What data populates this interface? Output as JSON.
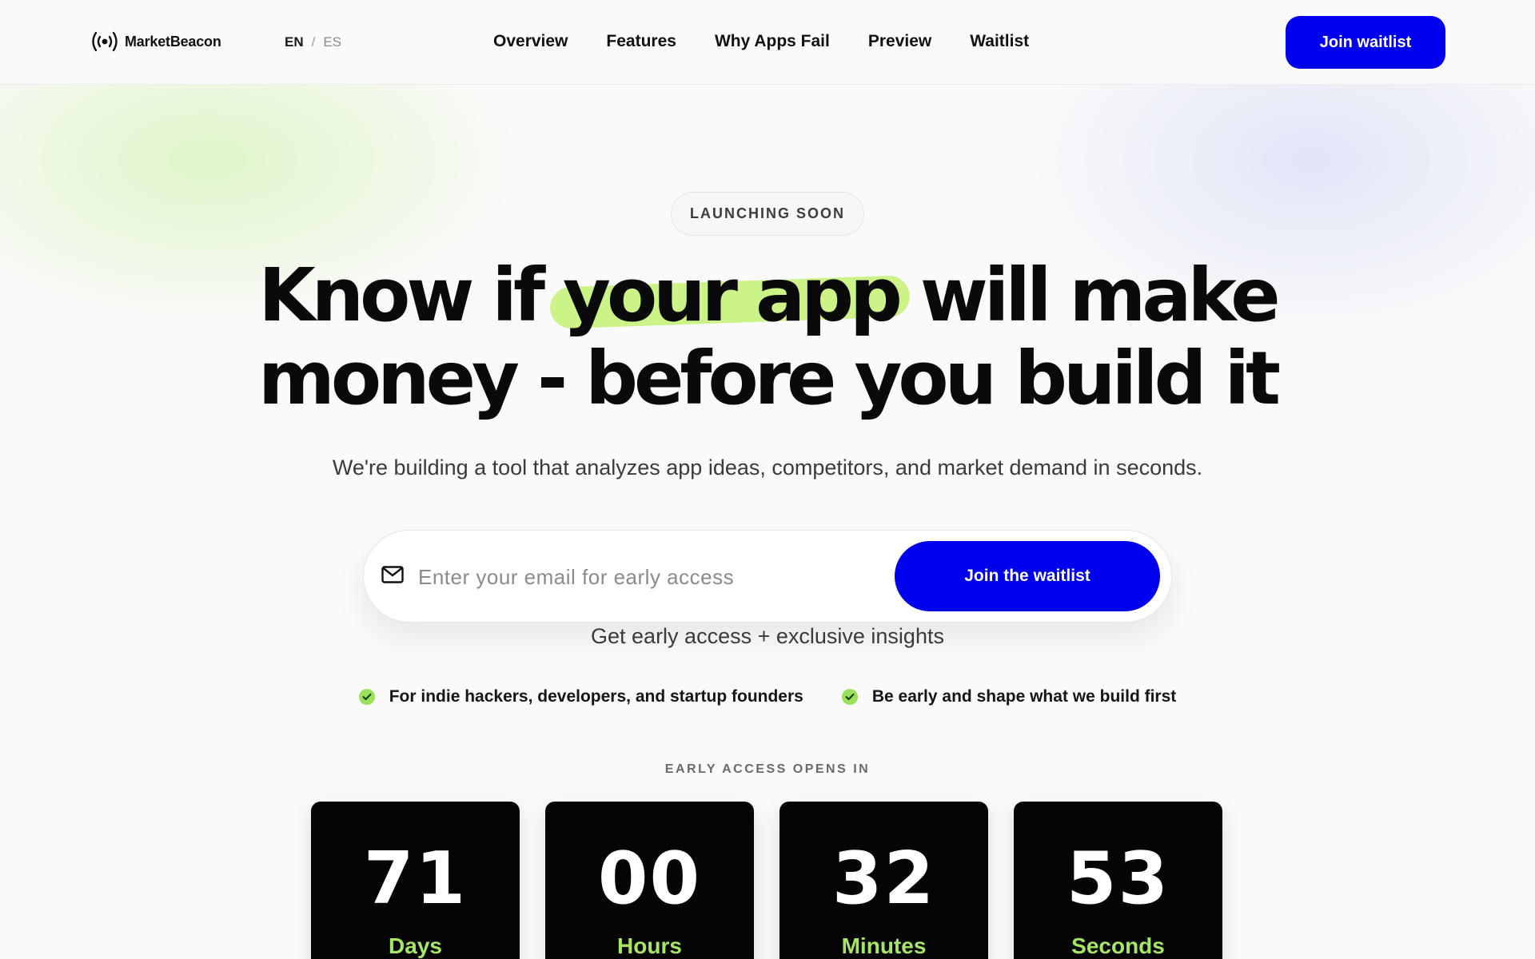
{
  "brand": {
    "name": "MarketBeacon",
    "icon": "broadcast-icon"
  },
  "language": {
    "current": "EN",
    "separator": "/",
    "other": "ES"
  },
  "nav": {
    "items": [
      "Overview",
      "Features",
      "Why Apps Fail",
      "Preview",
      "Waitlist"
    ],
    "cta": "Join waitlist"
  },
  "hero": {
    "badge": "LAUNCHING SOON",
    "headline_line1_pre": "Know if",
    "headline_highlight": "your app",
    "headline_line1_post": "will make",
    "headline_line2": "money - before you build it",
    "subtitle": "We're building a tool that analyzes app ideas, competitors, and market demand in seconds."
  },
  "form": {
    "email_placeholder": "Enter your email for early access",
    "email_value": "",
    "submit": "Join the waitlist",
    "note": "Get early access + exclusive insights"
  },
  "benefits": [
    "For indie hackers, developers, and startup founders",
    "Be early and shape what we build first"
  ],
  "countdown": {
    "label": "EARLY ACCESS OPENS IN",
    "units": [
      {
        "value": "71",
        "unit": "Days"
      },
      {
        "value": "00",
        "unit": "Hours"
      },
      {
        "value": "32",
        "unit": "Minutes"
      },
      {
        "value": "53",
        "unit": "Seconds"
      }
    ]
  },
  "colors": {
    "accent": "#0000ee",
    "highlight": "#c7f27a",
    "check": "#9be05a",
    "counter_unit": "#a6e665",
    "counter_bg": "#050505"
  }
}
